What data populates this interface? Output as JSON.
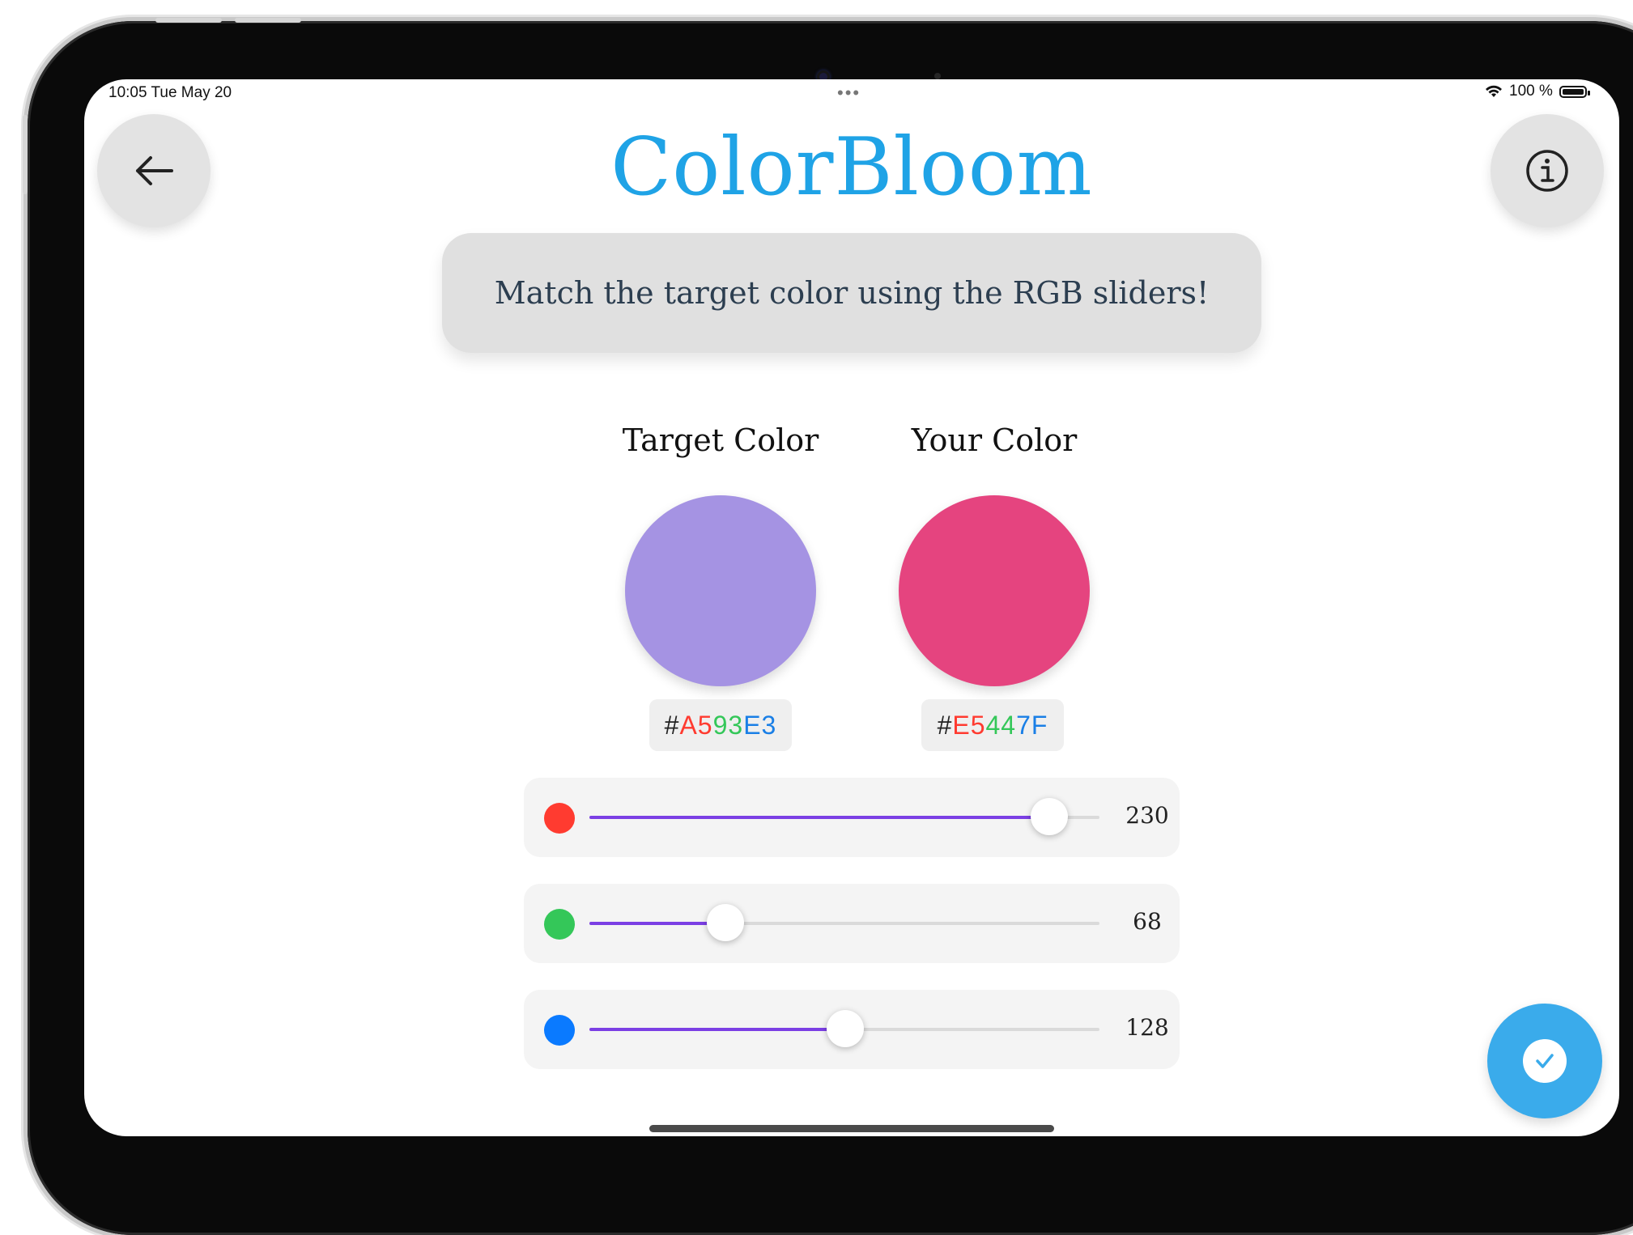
{
  "status_bar": {
    "time": "10:05  Tue May 20",
    "multitask": "•••",
    "battery": "100 %"
  },
  "header": {
    "title": "ColorBloom",
    "back_icon": "arrow-left-icon",
    "info_icon": "info-circle-icon"
  },
  "instruction": "Match the target color using the RGB sliders!",
  "target": {
    "label": "Target Color",
    "hex": {
      "prefix": "#",
      "r": "A5",
      "g": "93",
      "b": "E3"
    },
    "color": "#A593E3"
  },
  "yours": {
    "label": "Your Color",
    "hex": {
      "prefix": "#",
      "r": "E5",
      "g": "44",
      "b": "7F"
    },
    "color": "#E5447F"
  },
  "sliders": [
    {
      "channel": "red",
      "value": "230",
      "fraction": 0.902,
      "dot_color": "#ff3b30"
    },
    {
      "channel": "green",
      "value": "68",
      "fraction": 0.267,
      "dot_color": "#34c759"
    },
    {
      "channel": "blue",
      "value": "128",
      "fraction": 0.502,
      "dot_color": "#0a7aff"
    }
  ],
  "colors": {
    "accent": "#1fa3e6",
    "slider_fill": "#7b3fe4",
    "hex_red": "#ff3b30",
    "hex_green": "#34c759",
    "hex_blue": "#1a7fe6"
  },
  "confirm_icon": "checkmark-icon"
}
